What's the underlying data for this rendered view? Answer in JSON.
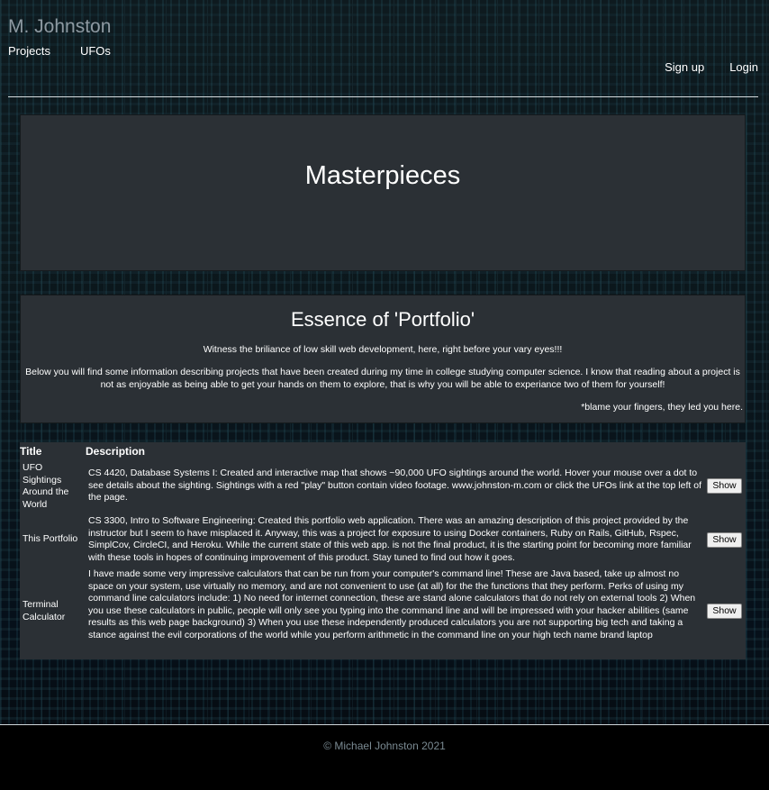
{
  "header": {
    "brand": "M. Johnston",
    "nav_left": [
      {
        "label": "Projects"
      },
      {
        "label": "UFOs"
      }
    ],
    "nav_right": [
      {
        "label": "Sign up"
      },
      {
        "label": "Login"
      }
    ]
  },
  "hero": {
    "title": "Masterpieces"
  },
  "about": {
    "title": "Essence of 'Portfolio'",
    "tagline": "Witness the briliance of low skill web development, here, right before your vary eyes!!!",
    "body": "Below you will find some information describing projects that have been created during my time in college studying computer science. I know that reading about a project is not as enjoyable as being able to get your hands on them to explore, that is why you will be able to experiance two of them for yourself!",
    "note": "*blame your fingers, they led you here."
  },
  "projects": {
    "columns": [
      "Title",
      "Description"
    ],
    "rows": [
      {
        "title": "UFO Sightings Around the World",
        "description": "CS 4420, Database Systems I: Created and interactive map that shows ~90,000 UFO sightings around the world. Hover your mouse over a dot to see details about the sighting. Sightings with a red \"play\" button contain video footage. www.johnston-m.com or click the UFOs link at the top left of the page.",
        "button": "Show"
      },
      {
        "title": "This Portfolio",
        "description": "CS 3300, Intro to Software Engineering: Created this portfolio web application. There was an amazing description of this project provided by the instructor but I seem to have misplaced it. Anyway, this was a project for exposure to using Docker containers, Ruby on Rails, GitHub, Rspec, SimplCov, CircleCI, and Heroku. While the current state of this web app. is not the final product, it is the starting point for becoming more familiar with these tools in hopes of continuing improvement of this product. Stay tuned to find out how it goes.",
        "button": "Show"
      },
      {
        "title": "Terminal Calculator",
        "description": "I have made some very impressive calculators that can be run from your computer's command line! These are Java based, take up almost no space on your system, use virtually no memory, and are not convenient to use (at all) for the the functions that they perform. Perks of using my command line calculators include: 1) No need for internet connection, these are stand alone calculators that do not rely on external tools 2) When you use these calculators in public, people will only see you typing into the command line and will be impressed with your hacker abilities (same results as this web page background) 3) When you use these independently produced calculators you are not supporting big tech and taking a stance against the evil corporations of the world while you perform arithmetic in the command line on your high tech name brand laptop",
        "button": "Show"
      }
    ]
  },
  "footer": {
    "text": "© Michael Johnston 2021"
  },
  "colors": {
    "panel": "#2b3035",
    "brand": "#8e9aa2",
    "footer_text": "#7a8a92",
    "background": "#0a1418"
  }
}
